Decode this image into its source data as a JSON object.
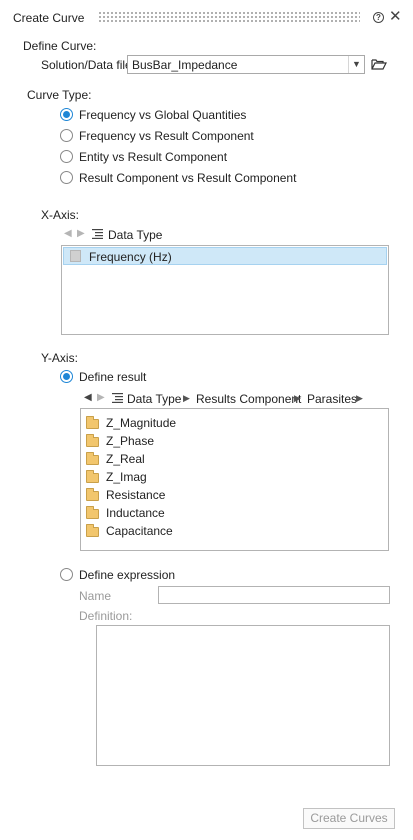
{
  "title": "Create Curve",
  "define_curve": {
    "heading": "Define Curve:",
    "solution_label": "Solution/Data file",
    "solution_value": "BusBar_Impedance"
  },
  "curve_type": {
    "heading": "Curve Type:",
    "options": [
      {
        "label": "Frequency vs Global Quantities",
        "checked": true
      },
      {
        "label": "Frequency vs Result Component",
        "checked": false
      },
      {
        "label": "Entity vs Result Component",
        "checked": false
      },
      {
        "label": "Result Component vs Result Component",
        "checked": false
      }
    ]
  },
  "x_axis": {
    "heading": "X-Axis:",
    "toolbar_label": "Data Type",
    "items": [
      "Frequency (Hz)"
    ]
  },
  "y_axis": {
    "heading": "Y-Axis:",
    "define_result_label": "Define result",
    "breadcrumb": [
      "Data Type",
      "Results Component",
      "Parasites"
    ],
    "results": [
      "Z_Magnitude",
      "Z_Phase",
      "Z_Real",
      "Z_Imag",
      "Resistance",
      "Inductance",
      "Capacitance"
    ],
    "define_expression_label": "Define expression",
    "name_label": "Name",
    "definition_label": "Definition:"
  },
  "create_button_label": "Create Curves",
  "colors": {
    "accent": "#1e86d6",
    "selection": "#cfe8f8",
    "folder": "#f2c66d"
  }
}
